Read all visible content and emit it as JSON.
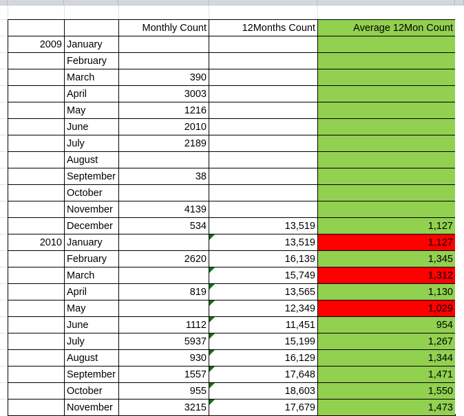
{
  "sheet": {
    "columns": [
      {
        "key": "year",
        "label": "",
        "align": "right"
      },
      {
        "key": "month",
        "label": "",
        "align": "left"
      },
      {
        "key": "monthly",
        "label": "Monthly Count",
        "align": "right"
      },
      {
        "key": "twelve",
        "label": "12Months Count",
        "align": "right"
      },
      {
        "key": "average",
        "label": "Average 12Mon Count",
        "align": "right"
      }
    ],
    "header": {
      "year": "",
      "month": "",
      "monthly_count": "Monthly Count",
      "twelve_months_count": "12Months Count",
      "average_12mon_count": "Average 12Mon Count"
    },
    "colors": {
      "green_fill": "#92D050",
      "red_fill": "#FF0000",
      "grid_line": "#DFE1E4",
      "cell_border": "#000000",
      "column_header_band": "#D4D8DD",
      "comment_marker": "#13711A"
    },
    "rows": [
      {
        "year": "",
        "month": "",
        "monthly": "",
        "twelve": "",
        "average": "",
        "avg_fill": "green",
        "comment": false
      },
      {
        "year": "2009",
        "month": "January",
        "monthly": "",
        "twelve": "",
        "average": "",
        "avg_fill": "green",
        "comment": false
      },
      {
        "year": "",
        "month": "February",
        "monthly": "",
        "twelve": "",
        "average": "",
        "avg_fill": "green",
        "comment": false
      },
      {
        "year": "",
        "month": "March",
        "monthly": "390",
        "twelve": "",
        "average": "",
        "avg_fill": "green",
        "comment": false
      },
      {
        "year": "",
        "month": "April",
        "monthly": "3003",
        "twelve": "",
        "average": "",
        "avg_fill": "green",
        "comment": false
      },
      {
        "year": "",
        "month": "May",
        "monthly": "1216",
        "twelve": "",
        "average": "",
        "avg_fill": "green",
        "comment": false
      },
      {
        "year": "",
        "month": "June",
        "monthly": "2010",
        "twelve": "",
        "average": "",
        "avg_fill": "green",
        "comment": false
      },
      {
        "year": "",
        "month": "July",
        "monthly": "2189",
        "twelve": "",
        "average": "",
        "avg_fill": "green",
        "comment": false
      },
      {
        "year": "",
        "month": "August",
        "monthly": "",
        "twelve": "",
        "average": "",
        "avg_fill": "green",
        "comment": false
      },
      {
        "year": "",
        "month": "September",
        "monthly": "38",
        "twelve": "",
        "average": "",
        "avg_fill": "green",
        "comment": false
      },
      {
        "year": "",
        "month": "October",
        "monthly": "",
        "twelve": "",
        "average": "",
        "avg_fill": "green",
        "comment": false
      },
      {
        "year": "",
        "month": "November",
        "monthly": "4139",
        "twelve": "",
        "average": "",
        "avg_fill": "green",
        "comment": false
      },
      {
        "year": "",
        "month": "December",
        "monthly": "534",
        "twelve": "13,519",
        "average": "1,127",
        "avg_fill": "green",
        "comment": false
      },
      {
        "year": "2010",
        "month": "January",
        "monthly": "",
        "twelve": "13,519",
        "average": "1,127",
        "avg_fill": "red",
        "comment": true
      },
      {
        "year": "",
        "month": "February",
        "monthly": "2620",
        "twelve": "16,139",
        "average": "1,345",
        "avg_fill": "green",
        "comment": false
      },
      {
        "year": "",
        "month": "March",
        "monthly": "",
        "twelve": "15,749",
        "average": "1,312",
        "avg_fill": "red",
        "comment": true
      },
      {
        "year": "",
        "month": "April",
        "monthly": "819",
        "twelve": "13,565",
        "average": "1,130",
        "avg_fill": "green",
        "comment": true
      },
      {
        "year": "",
        "month": "May",
        "monthly": "",
        "twelve": "12,349",
        "average": "1,029",
        "avg_fill": "red",
        "comment": true
      },
      {
        "year": "",
        "month": "June",
        "monthly": "1112",
        "twelve": "11,451",
        "average": "954",
        "avg_fill": "green",
        "comment": true
      },
      {
        "year": "",
        "month": "July",
        "monthly": "5937",
        "twelve": "15,199",
        "average": "1,267",
        "avg_fill": "green",
        "comment": true
      },
      {
        "year": "",
        "month": "August",
        "monthly": "930",
        "twelve": "16,129",
        "average": "1,344",
        "avg_fill": "green",
        "comment": true
      },
      {
        "year": "",
        "month": "September",
        "monthly": "1557",
        "twelve": "17,648",
        "average": "1,471",
        "avg_fill": "green",
        "comment": true
      },
      {
        "year": "",
        "month": "October",
        "monthly": "955",
        "twelve": "18,603",
        "average": "1,550",
        "avg_fill": "green",
        "comment": true
      },
      {
        "year": "",
        "month": "November",
        "monthly": "3215",
        "twelve": "17,679",
        "average": "1,473",
        "avg_fill": "green",
        "comment": true
      }
    ]
  }
}
